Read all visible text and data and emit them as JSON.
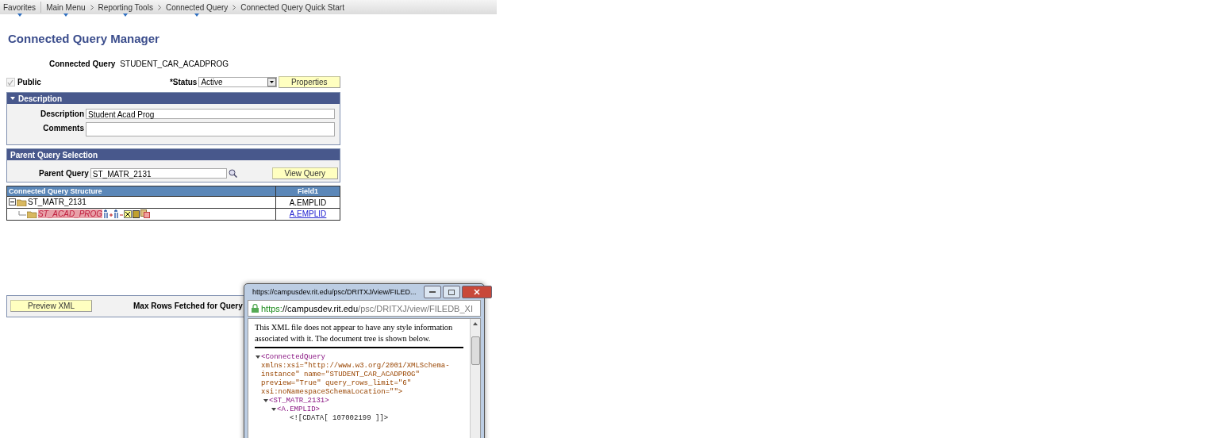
{
  "breadcrumbs": [
    {
      "label": "Favorites",
      "menu": true
    },
    {
      "label": "Main Menu",
      "menu": true
    },
    {
      "label": "Reporting Tools",
      "menu": true
    },
    {
      "label": "Connected Query",
      "menu": true
    },
    {
      "label": "Connected Query Quick Start",
      "menu": false
    }
  ],
  "page_title": "Connected Query Manager",
  "connected_query": {
    "label": "Connected Query",
    "value": "STUDENT_CAR_ACADPROG"
  },
  "public": {
    "label": "Public",
    "checked": true,
    "disabled": true
  },
  "status": {
    "label": "*Status",
    "value": "Active"
  },
  "properties_button": "Properties",
  "description_section": {
    "title": "Description",
    "expanded": true,
    "description_label": "Description",
    "description_value": "Student Acad Prog",
    "comments_label": "Comments"
  },
  "parent_section": {
    "title": "Parent Query Selection",
    "parent_label": "Parent Query",
    "parent_value": "ST_MATR_2131",
    "view_button": "View Query"
  },
  "structure_table": {
    "columns": [
      "Connected Query Structure",
      "Field1"
    ],
    "rows": [
      {
        "name": "ST_MATR_2131",
        "expanded": true,
        "selected": false,
        "field1": "A.EMPLID",
        "field1_link": false,
        "children": [
          {
            "name": "ST_ACAD_PROG",
            "selected": true,
            "field1": "A.EMPLID",
            "field1_link": true
          }
        ]
      }
    ]
  },
  "preview_button": "Preview XML",
  "max_rows_label": "Max Rows Fetched for Query",
  "popup": {
    "title": "https://campusdev.rit.edu/psc/DRITXJ/view/FILED...",
    "url_scheme": "https:",
    "url_host": "//campusdev.rit.edu",
    "url_path": "/psc/DRITXJ/view/FILEDB_XI",
    "notice": "This XML file does not appear to have any style information associated with it. The document tree is shown below.",
    "xml": {
      "open": "<ConnectedQuery",
      "expanded": true,
      "attribute_lines": [
        "xmlns:xsi=\"http://www.w3.org/2001/XMLSchema-",
        "instance\" name=\"STUDENT_CAR_ACADPROG\"",
        "preview=\"True\" query_rows_limit=\"6\"",
        "xsi:noNamespaceSchemaLocation=\"\">"
      ],
      "children": [
        {
          "open": "<ST_MATR_2131>",
          "expanded": true,
          "children": [
            {
              "open": "<A.EMPLID>",
              "expanded": true,
              "cdata": "<![CDATA[ 107002199 ]]>"
            }
          ]
        }
      ]
    }
  }
}
